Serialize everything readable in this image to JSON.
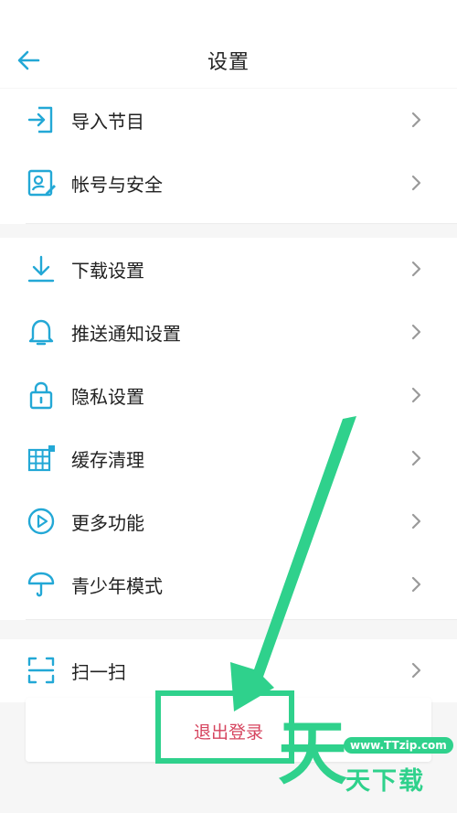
{
  "header": {
    "title": "设置",
    "back_icon": "arrow-left-icon"
  },
  "section1": [
    {
      "id": "import",
      "label": "导入节目",
      "icon": "import-icon"
    },
    {
      "id": "account",
      "label": "帐号与安全",
      "icon": "account-security-icon"
    }
  ],
  "section2": [
    {
      "id": "download",
      "label": "下载设置",
      "icon": "download-icon"
    },
    {
      "id": "notify",
      "label": "推送通知设置",
      "icon": "bell-icon"
    },
    {
      "id": "privacy",
      "label": "隐私设置",
      "icon": "lock-icon"
    },
    {
      "id": "cache",
      "label": "缓存清理",
      "icon": "grid-icon"
    },
    {
      "id": "more",
      "label": "更多功能",
      "icon": "play-circle-icon"
    },
    {
      "id": "teen",
      "label": "青少年模式",
      "icon": "umbrella-icon"
    }
  ],
  "section3": [
    {
      "id": "scan",
      "label": "扫一扫",
      "icon": "scan-icon"
    }
  ],
  "logout": {
    "label": "退出登录"
  },
  "watermark": {
    "big": "天",
    "url": "www.TTzip.com",
    "name": "天下载"
  },
  "colors": {
    "icon": "#23a8d6",
    "accent": "#2fd18c",
    "logout_text": "#d6455f",
    "chevron": "#9a9a9a"
  }
}
